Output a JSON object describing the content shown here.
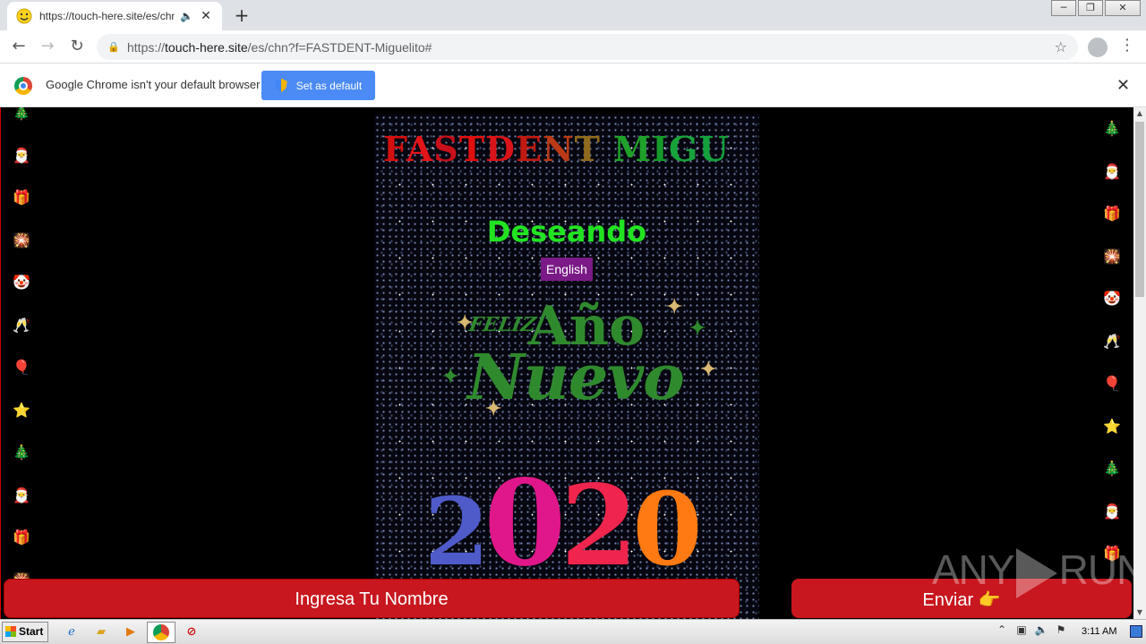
{
  "browser": {
    "tab_title": "https://touch-here.site/es/chn?f",
    "tab_favicon": "smiley-face-icon",
    "new_tab_label": "+",
    "url_scheme": "https://",
    "url_host": "touch-here.site",
    "url_path": "/es/chn?f=FASTDENT-Miguelito#"
  },
  "infobar": {
    "message": "Google Chrome isn't your default browser",
    "button_label": "Set as default",
    "close_label": "✕"
  },
  "page": {
    "marquee_title": "FASTDENT MIGU",
    "greeting": "Deseando",
    "language_button": "English",
    "feliz": "FELIZ",
    "ano": "Año",
    "nuevo": "Nuevo",
    "year_digits": [
      "2",
      "0",
      "2",
      "0"
    ],
    "name_input_placeholder": "Ingresa Tu Nombre",
    "send_button": "Enviar 👉",
    "left_emojis": [
      "🎄",
      "🎅",
      "🎁",
      "🎇",
      "🤡",
      "🥂",
      "🎈",
      "⭐",
      "🎄",
      "🎅",
      "🎁",
      "🎇"
    ],
    "right_emojis": [
      "🎄",
      "🎅",
      "🎁",
      "🎇",
      "🤡",
      "🥂",
      "🎈",
      "⭐",
      "🎄",
      "🎅",
      "🎁"
    ],
    "title_colors": [
      "#d40f0f",
      "#e0141a",
      "#c8101a",
      "#e01010",
      "#d8141a",
      "#c01a12",
      "#b83a16",
      "#8f6a1e",
      "#3a8a1f",
      "#1fa12a",
      "#159a2a",
      "#18a33a",
      "#14a03c"
    ]
  },
  "watermark": {
    "left": "ANY",
    "right": "RUN"
  },
  "taskbar": {
    "start_label": "Start",
    "clock": "3:11 AM"
  }
}
